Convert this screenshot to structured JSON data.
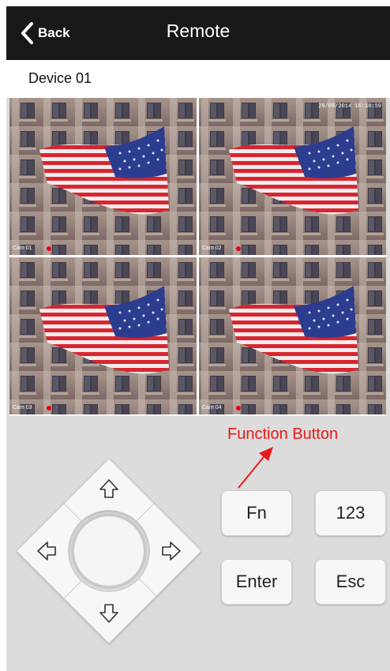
{
  "nav": {
    "back_label": "Back",
    "title": "Remote"
  },
  "device": {
    "name": "Device 01"
  },
  "video": {
    "timestamp": "29/09/2014 16:18:59",
    "cameras": [
      {
        "label": "Cam 01",
        "recording": true
      },
      {
        "label": "Cam 02",
        "recording": true
      },
      {
        "label": "Cam 03",
        "recording": true
      },
      {
        "label": "Cam 04",
        "recording": true
      }
    ]
  },
  "annotation": {
    "text": "Function Button",
    "color": "#e81a1a"
  },
  "dpad": {
    "up_icon": "arrow-up-icon",
    "down_icon": "arrow-down-icon",
    "left_icon": "arrow-left-icon",
    "right_icon": "arrow-right-icon"
  },
  "keys": {
    "fn": "Fn",
    "num": "123",
    "enter": "Enter",
    "esc": "Esc"
  },
  "colors": {
    "nav_bg": "#181818",
    "panel_bg": "#dcdcdc",
    "rec_dot": "#e8001a"
  }
}
